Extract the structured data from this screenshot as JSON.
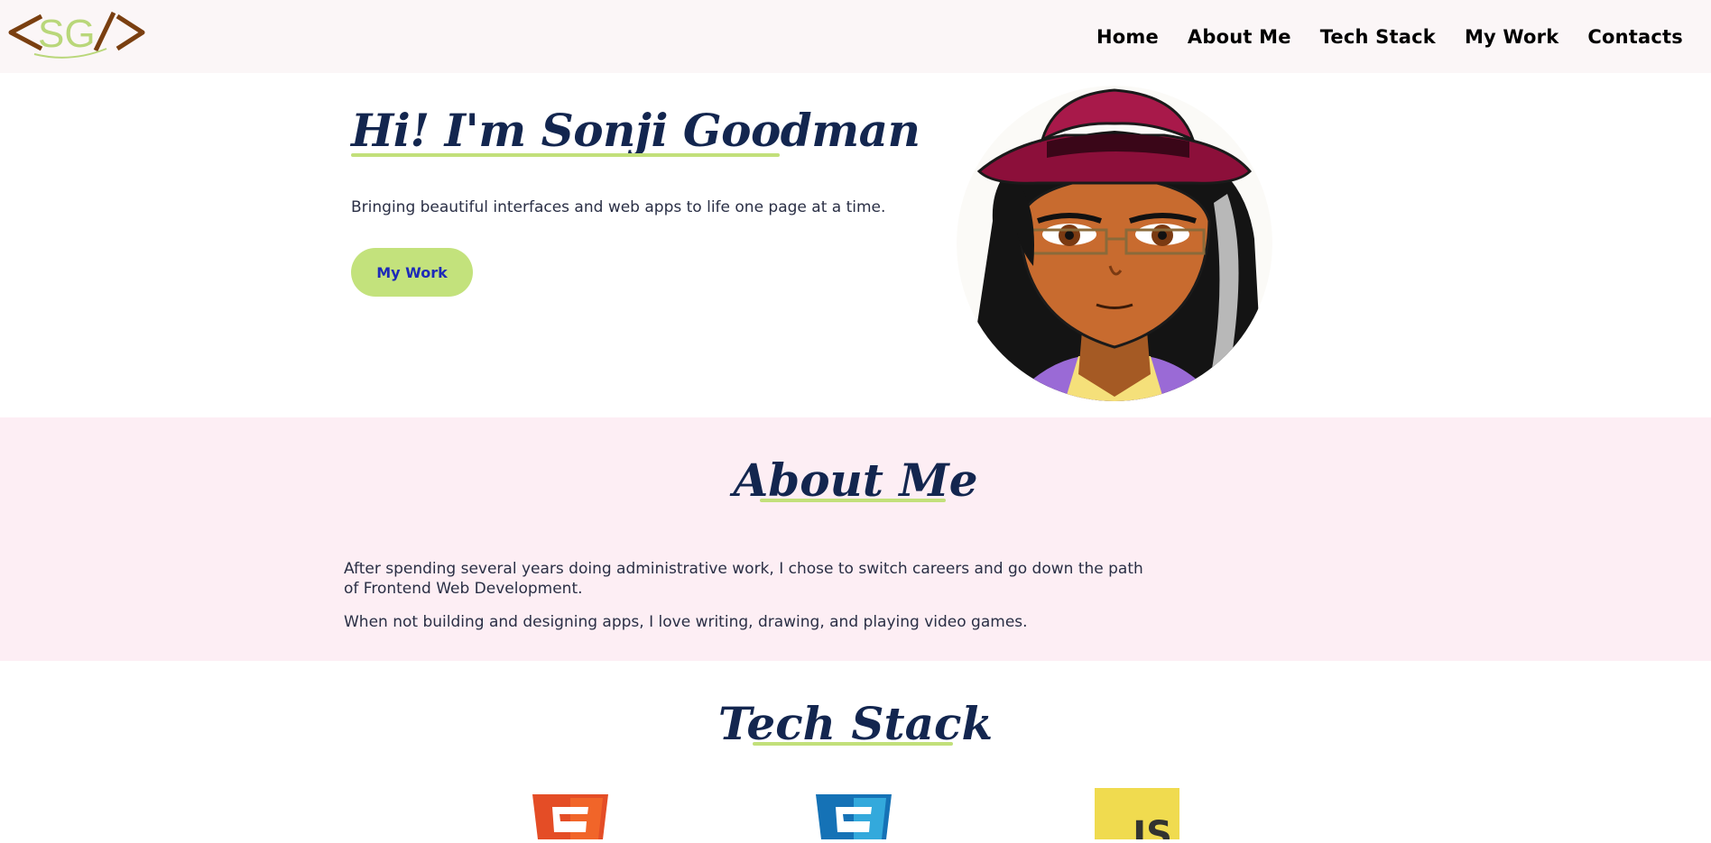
{
  "header": {
    "logo_text": "<SG/>",
    "nav": [
      "Home",
      "About Me",
      "Tech Stack",
      "My Work",
      "Contacts"
    ]
  },
  "hero": {
    "title": "Hi! I'm Sonji Goodman",
    "subtitle": "Bringing beautiful interfaces and web apps to life one page at a time.",
    "button_label": "My Work"
  },
  "about": {
    "title": "About Me",
    "paragraphs": [
      "After spending several years doing administrative work, I chose to switch careers and go down the path of Frontend Web Development.",
      "When not building and designing apps, I love writing, drawing, and playing video games."
    ]
  },
  "tech": {
    "title": "Tech Stack",
    "icons": [
      "html5-icon",
      "css3-icon",
      "javascript-icon"
    ],
    "js_label": "JS"
  },
  "colors": {
    "header_bg": "#fbf6f7",
    "title": "#13264f",
    "accent_green": "#c3e27c",
    "about_bg": "#fdeef4",
    "button_text": "#1d2ab8"
  }
}
